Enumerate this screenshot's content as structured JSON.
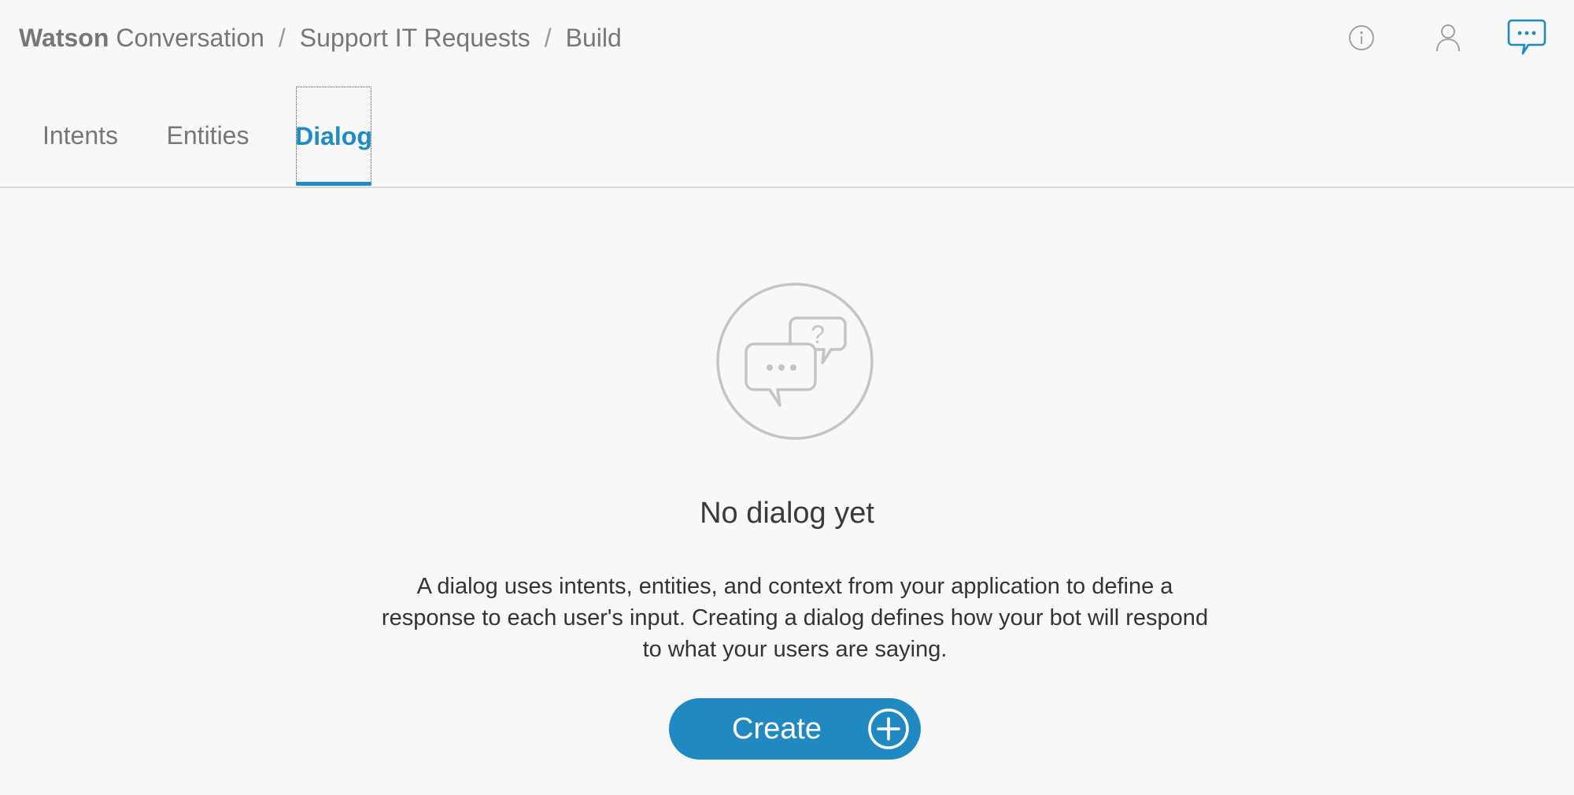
{
  "header": {
    "brand_bold": "Watson",
    "brand_light": "Conversation",
    "breadcrumb": {
      "separator": "/",
      "workspace": "Support IT Requests",
      "page": "Build"
    },
    "icons": {
      "info": "info-icon",
      "user": "user-icon",
      "chat": "chat-icon"
    }
  },
  "tabs": [
    {
      "label": "Intents",
      "active": false
    },
    {
      "label": "Entities",
      "active": false
    },
    {
      "label": "Dialog",
      "active": true
    }
  ],
  "empty_state": {
    "illustration": "dialog-bubbles-icon",
    "title": "No dialog yet",
    "description": "A dialog uses intents, entities, and context from your application to define a response to each user's input. Creating a dialog defines how your bot will respond to what your users are saying.",
    "button_label": "Create",
    "button_icon": "plus-circle-icon"
  },
  "colors": {
    "accent": "#2089c2",
    "text_muted": "#777777",
    "text_dark": "#333333",
    "background": "#f8f8f8",
    "divider": "#d8d8d8",
    "illustration_gray": "#c4c4c4"
  }
}
